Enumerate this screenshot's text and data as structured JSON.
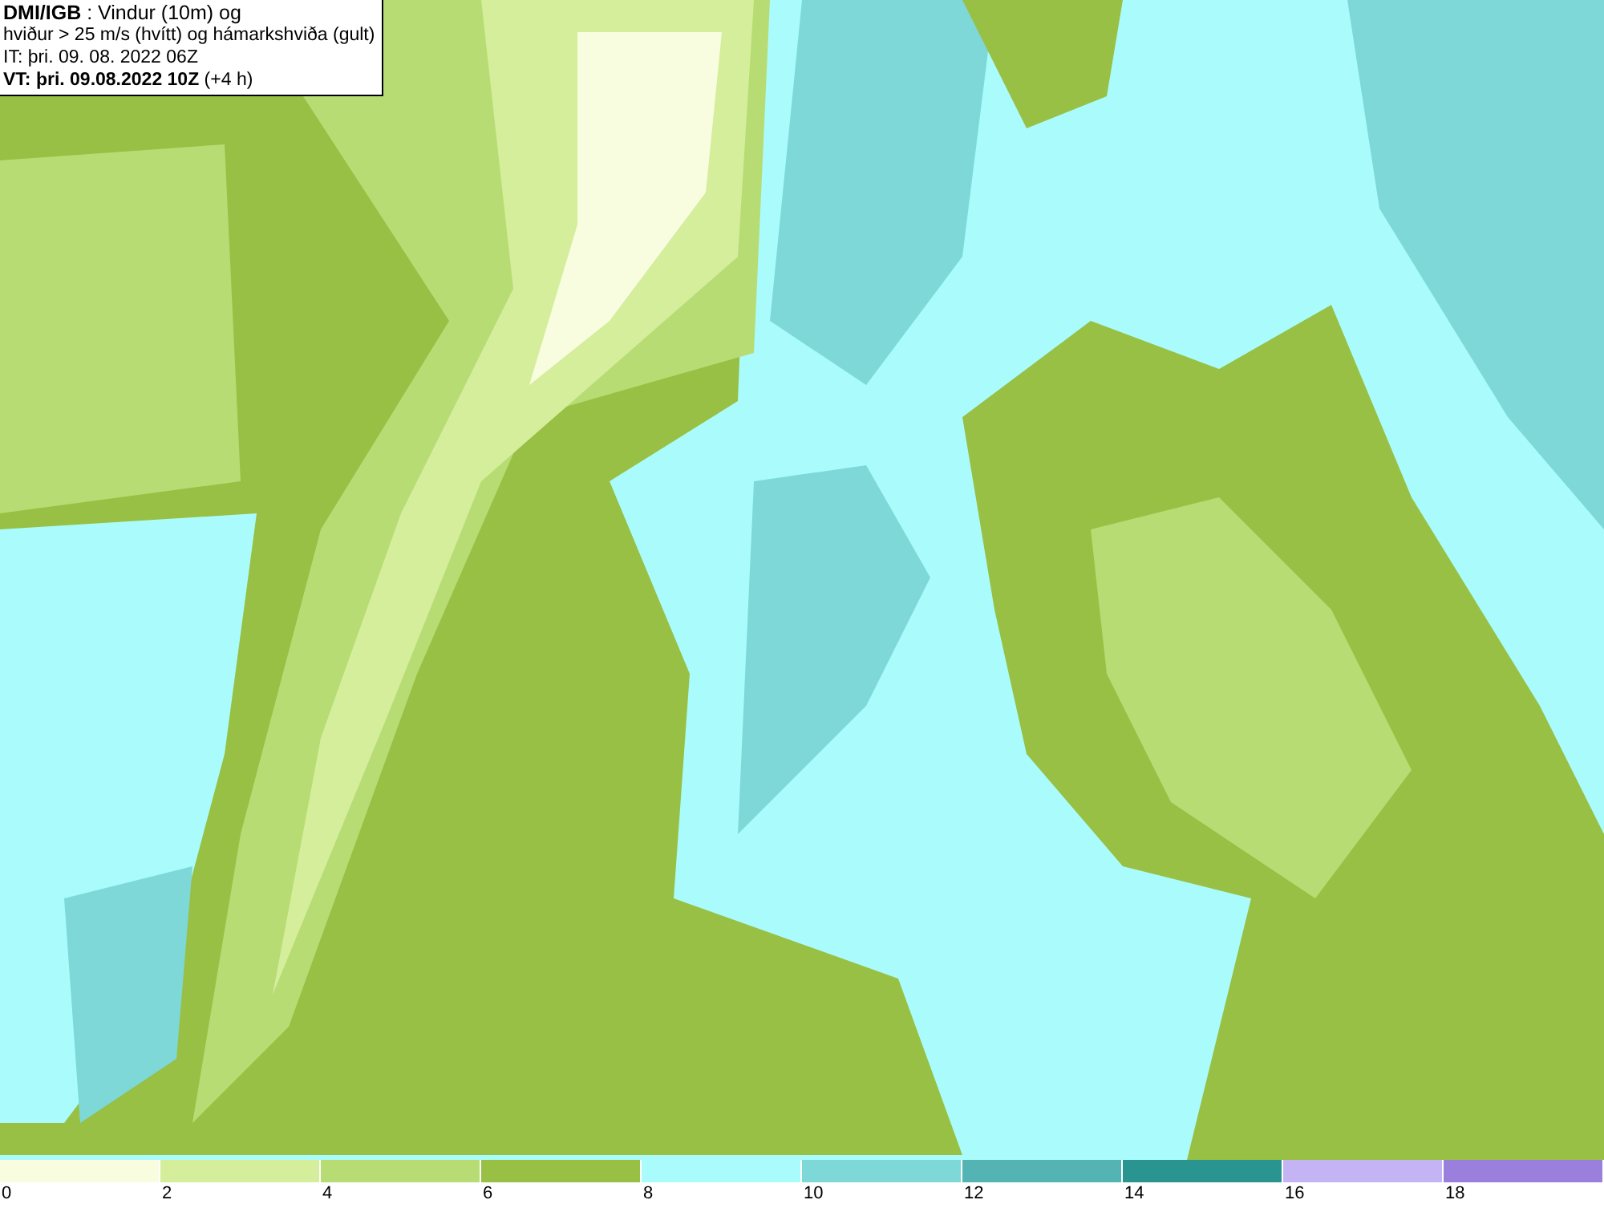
{
  "legend_box": {
    "lines": [
      "**DMI/IGB** : Vindur (10m) og",
      "hviður > 25 m/s (hvítt) og hámarkshviða (gult)",
      "IT: þri. 09. 08. 2022 06Z",
      "**VT: þri. 09.08.2022 10Z** (+4 h)"
    ]
  },
  "color_scale": {
    "segments": [
      {
        "label": "0",
        "color": "#f8fde0"
      },
      {
        "label": "2",
        "color": "#d5ee9c"
      },
      {
        "label": "4",
        "color": "#b8dc74"
      },
      {
        "label": "6",
        "color": "#98c044"
      },
      {
        "label": "8",
        "color": "#aafcfc"
      },
      {
        "label": "10",
        "color": "#7ed8d8"
      },
      {
        "label": "12",
        "color": "#54b4b4"
      },
      {
        "label": "14",
        "color": "#2a9490"
      },
      {
        "label": "16",
        "color": "#c4b4f4"
      },
      {
        "label": "18",
        "color": "#9a80dc"
      }
    ]
  }
}
